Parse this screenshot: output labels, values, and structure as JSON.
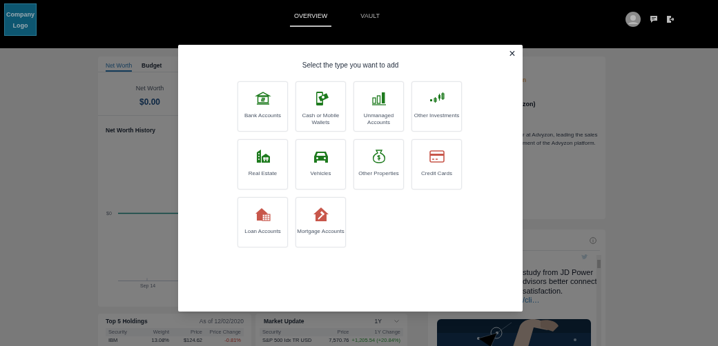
{
  "header": {
    "logo": "Company Logo",
    "nav": [
      {
        "label": "OVERVIEW",
        "selected": true
      },
      {
        "label": "VAULT",
        "selected": false
      }
    ]
  },
  "net_worth_card": {
    "tabs": [
      {
        "label": "Net Worth",
        "selected": true
      },
      {
        "label": "Budget",
        "selected": false
      }
    ],
    "summary_label": "Net Worth",
    "summary_value": "$0.00",
    "history_title": "Net Worth History",
    "y_tick": "$0",
    "x_tick": "Sep 14"
  },
  "profile_card": {
    "heading_fragment": "n",
    "name_fragment": "zon)",
    "bio_lines": [
      "r at Advyzon, leading the sales",
      "ment of the Advyzon platform."
    ]
  },
  "news_card": {
    "tweet_lines": [
      "study from JD Power",
      "dvisors better connect",
      "satisfaction."
    ],
    "tweet_link": "/cli…",
    "image": {
      "kind": "picture"
    }
  },
  "holdings": {
    "title": "Top 5 Holdings",
    "as_of": "As of 12/02/2020",
    "columns": [
      "Security",
      "Weight",
      "Price",
      "Price Change"
    ],
    "rows": [
      [
        "IBM",
        "13.08%",
        "$124.62",
        "-0.81%"
      ]
    ]
  },
  "market": {
    "title": "Market Update",
    "period": "1Y",
    "columns": [
      "Security",
      "Price",
      "1Y Change"
    ],
    "rows": [
      [
        "S&P 500 Idx TR USD",
        "7,570.76",
        "+1,205.54 (+20.84%)"
      ]
    ]
  },
  "modal": {
    "title": "Select the type you want to add",
    "close": "×",
    "items": [
      {
        "label": "Bank Accounts",
        "kind": "bank",
        "color": "#1e7b1e"
      },
      {
        "label": "Cash or Mobile Wallets",
        "kind": "cash",
        "color": "#1e7b1e"
      },
      {
        "label": "Unmanaged Accounts",
        "kind": "bars",
        "color": "#1e7b1e"
      },
      {
        "label": "Other Investments",
        "kind": "candles",
        "color": "#1e7b1e"
      },
      {
        "label": "Real Estate",
        "kind": "buildings",
        "color": "#1e7b1e"
      },
      {
        "label": "Vehicles",
        "kind": "car",
        "color": "#1e7b1e"
      },
      {
        "label": "Other Properties",
        "kind": "moneybag",
        "color": "#1e7b1e"
      },
      {
        "label": "Credit Cards",
        "kind": "card",
        "color": "#c8574b"
      },
      {
        "label": "Loan Accounts",
        "kind": "house_calendar",
        "color": "#c8574b"
      },
      {
        "label": "Mortgage Accounts",
        "kind": "house_hammer",
        "color": "#c8574b"
      }
    ]
  }
}
